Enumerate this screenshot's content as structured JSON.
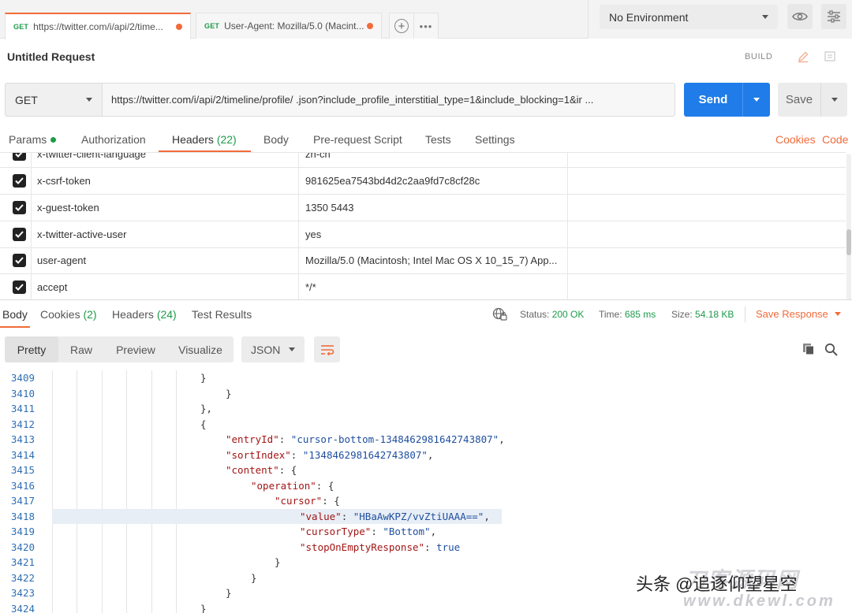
{
  "tabs": [
    {
      "method": "GET",
      "label": "https://twitter.com/i/api/2/time..."
    },
    {
      "method": "GET",
      "label": "User-Agent: Mozilla/5.0 (Macint..."
    }
  ],
  "environment": {
    "selected": "No Environment"
  },
  "request": {
    "name": "Untitled Request",
    "build_label": "BUILD",
    "method": "GET",
    "url": "https://twitter.com/i/api/2/timeline/profile/            .json?include_profile_interstitial_type=1&include_blocking=1&ir ...",
    "send_label": "Send",
    "save_label": "Save"
  },
  "request_tabs": {
    "params": "Params",
    "authorization": "Authorization",
    "headers": "Headers",
    "headers_count": "(22)",
    "body": "Body",
    "prerequest": "Pre-request Script",
    "tests": "Tests",
    "settings": "Settings",
    "cookies": "Cookies",
    "code": "Code"
  },
  "headers_table": [
    {
      "key": "x-twitter-client-language",
      "value": "zh-cn"
    },
    {
      "key": "x-csrf-token",
      "value": "981625ea7543bd4d2c2aa9fd7c8cf28c"
    },
    {
      "key": "x-guest-token",
      "value": "1350              5443"
    },
    {
      "key": "x-twitter-active-user",
      "value": "yes"
    },
    {
      "key": "user-agent",
      "value": "Mozilla/5.0 (Macintosh; Intel Mac OS X 10_15_7) App..."
    },
    {
      "key": "accept",
      "value": "*/*"
    }
  ],
  "response": {
    "tabs": {
      "body": "Body",
      "cookies": "Cookies",
      "cookies_count": "(2)",
      "headers": "Headers",
      "headers_count": "(24)",
      "test_results": "Test Results"
    },
    "status_label": "Status:",
    "status_value": "200 OK",
    "time_label": "Time:",
    "time_value": "685 ms",
    "size_label": "Size:",
    "size_value": "54.18 KB",
    "save_response": "Save Response",
    "view_modes": [
      "Pretty",
      "Raw",
      "Preview",
      "Visualize"
    ],
    "format": "JSON"
  },
  "code_lines": [
    {
      "n": "3409",
      "t": "}"
    },
    {
      "n": "3410",
      "t": "}"
    },
    {
      "n": "3411",
      "t": "},"
    },
    {
      "n": "3412",
      "t": "{"
    },
    {
      "n": "3413",
      "k": "\"entryId\"",
      "v": "\"cursor-bottom-1348462981642743807\"",
      "e": ","
    },
    {
      "n": "3414",
      "k": "\"sortIndex\"",
      "v": "\"1348462981642743807\"",
      "e": ","
    },
    {
      "n": "3415",
      "k": "\"content\"",
      "e": " {"
    },
    {
      "n": "3416",
      "k": "\"operation\"",
      "e": " {"
    },
    {
      "n": "3417",
      "k": "\"cursor\"",
      "e": " {"
    },
    {
      "n": "3418",
      "k": "\"value\"",
      "v": "\"HBaAwKPZ/vvZtiUAAA==\"",
      "e": ","
    },
    {
      "n": "3419",
      "k": "\"cursorType\"",
      "v": "\"Bottom\"",
      "e": ","
    },
    {
      "n": "3420",
      "k": "\"stopOnEmptyResponse\"",
      "v": "true",
      "e": ""
    },
    {
      "n": "3421",
      "t": "}"
    },
    {
      "n": "3422",
      "t": "}"
    },
    {
      "n": "3423",
      "t": "}"
    },
    {
      "n": "3424",
      "t": "}"
    }
  ],
  "watermark": {
    "text": "头条 @追逐仰望星空",
    "site_top": "刀客源码网",
    "site_bottom": "www.dkewl.com"
  }
}
